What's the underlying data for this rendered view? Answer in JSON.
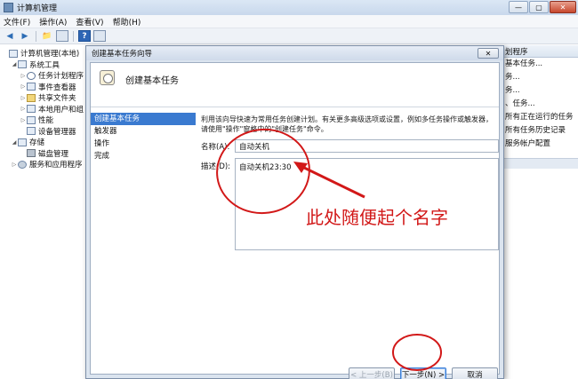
{
  "window": {
    "title": "计算机管理"
  },
  "menu": [
    "文件(F)",
    "操作(A)",
    "查看(V)",
    "帮助(H)"
  ],
  "tree": [
    {
      "label": "计算机管理(本地)",
      "indent": 0,
      "twisty": "",
      "icon": "computer"
    },
    {
      "label": "系统工具",
      "indent": 1,
      "twisty": "◢",
      "icon": "tools"
    },
    {
      "label": "任务计划程序",
      "indent": 2,
      "twisty": "▷",
      "icon": "clock"
    },
    {
      "label": "事件查看器",
      "indent": 2,
      "twisty": "▷",
      "icon": "log"
    },
    {
      "label": "共享文件夹",
      "indent": 2,
      "twisty": "▷",
      "icon": "folder"
    },
    {
      "label": "本地用户和组",
      "indent": 2,
      "twisty": "▷",
      "icon": "users"
    },
    {
      "label": "性能",
      "indent": 2,
      "twisty": "▷",
      "icon": "gauge"
    },
    {
      "label": "设备管理器",
      "indent": 2,
      "twisty": "",
      "icon": "device"
    },
    {
      "label": "存储",
      "indent": 1,
      "twisty": "◢",
      "icon": "storage"
    },
    {
      "label": "磁盘管理",
      "indent": 2,
      "twisty": "",
      "icon": "disk"
    },
    {
      "label": "服务和应用程序",
      "indent": 1,
      "twisty": "▷",
      "icon": "gear"
    }
  ],
  "actions": {
    "header": "划程序",
    "items": [
      "基本任务...",
      "务...",
      "务...",
      "、任务...",
      "所有正在运行的任务",
      "所有任务历史记录",
      "服务帐户配置"
    ]
  },
  "dialog": {
    "title": "创建基本任务向导",
    "close_label": "✕",
    "header": "创建基本任务",
    "steps": [
      "创建基本任务",
      "触发器",
      "操作",
      "完成"
    ],
    "active_step": 0,
    "description": "利用该向导快速为常用任务创建计划。有关更多高级选项或设置，例如多任务操作或触发器，请使用\"操作\"窗格中的\"创建任务\"命令。",
    "name_label": "名称(A):",
    "name_value": "自动关机",
    "desc_label": "描述(D):",
    "desc_value": "自动关机23:30",
    "back_button": "< 上一步(B)",
    "next_button": "下一步(N) >",
    "cancel_button": "取消"
  },
  "annotation": {
    "text": "此处随便起个名字",
    "color": "#d21818"
  }
}
